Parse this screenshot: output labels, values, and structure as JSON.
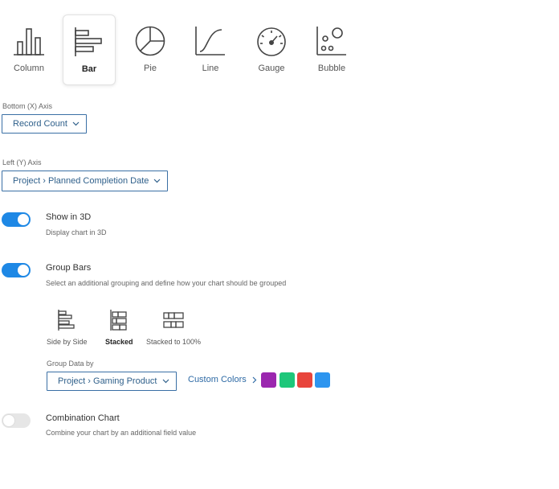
{
  "chart_types": [
    {
      "label": "Column",
      "icon": "column-chart-icon",
      "selected": false
    },
    {
      "label": "Bar",
      "icon": "bar-chart-icon",
      "selected": true
    },
    {
      "label": "Pie",
      "icon": "pie-chart-icon",
      "selected": false
    },
    {
      "label": "Line",
      "icon": "line-chart-icon",
      "selected": false
    },
    {
      "label": "Gauge",
      "icon": "gauge-chart-icon",
      "selected": false
    },
    {
      "label": "Bubble",
      "icon": "bubble-chart-icon",
      "selected": false
    }
  ],
  "x_axis": {
    "label": "Bottom (X) Axis",
    "value": "Record Count"
  },
  "y_axis": {
    "label": "Left (Y) Axis",
    "value": "Project › Planned Completion Date"
  },
  "show_3d": {
    "title": "Show in 3D",
    "description": "Display chart in 3D",
    "enabled": true
  },
  "group_bars": {
    "title": "Group Bars",
    "description": "Select an additional grouping and define how your chart should be grouped",
    "enabled": true,
    "modes": [
      {
        "label": "Side by Side",
        "icon": "side-by-side-icon",
        "selected": false
      },
      {
        "label": "Stacked",
        "icon": "stacked-icon",
        "selected": true
      },
      {
        "label": "Stacked to 100%",
        "icon": "stacked-100-icon",
        "selected": false
      }
    ],
    "group_data_label": "Group Data by",
    "group_data_value": "Project › Gaming Product",
    "custom_colors_label": "Custom Colors",
    "colors": [
      "#9b27af",
      "#1ec77a",
      "#e8453c",
      "#2d95ef"
    ]
  },
  "combination_chart": {
    "title": "Combination Chart",
    "description": "Combine your chart by an additional field value",
    "enabled": false
  },
  "accent_color": "#1e88e5"
}
